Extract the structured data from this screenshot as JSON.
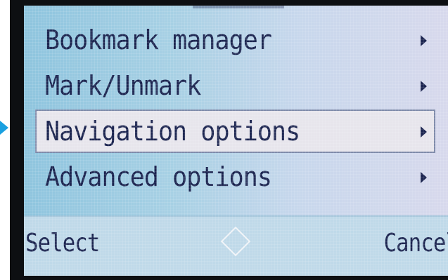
{
  "menu": {
    "items": [
      {
        "label": "Bookmark manager",
        "selected": false,
        "icon": "chevron-right-icon"
      },
      {
        "label": "Mark/Unmark",
        "selected": false,
        "icon": "chevron-right-icon"
      },
      {
        "label": "Navigation options",
        "selected": true,
        "icon": "chevron-right-icon"
      },
      {
        "label": "Advanced options",
        "selected": false,
        "icon": "chevron-right-icon"
      }
    ]
  },
  "softkeys": {
    "left_label": "Select",
    "right_label": "Cancel",
    "center_icon": "navigation-diamond-icon"
  },
  "colors": {
    "text": "#1c2550",
    "screen_bg": "#a7d0e4",
    "selection_bg": "#e7e5ec",
    "pointer": "#1aa0e0"
  }
}
